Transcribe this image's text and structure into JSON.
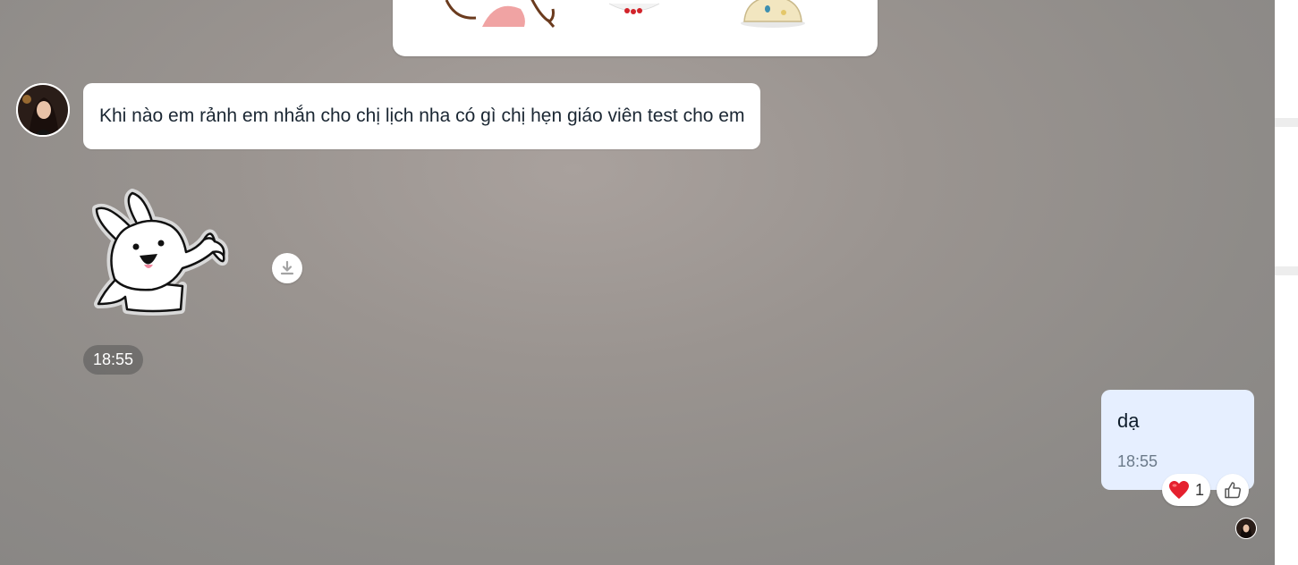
{
  "incoming_message": {
    "text": "Khi nào em rảnh em nhắn cho chị lịch nha có gì chị hẹn giáo viên test cho em",
    "sticker_time": "18:55"
  },
  "outgoing_message": {
    "text": "dạ",
    "time": "18:55",
    "reaction": {
      "icon": "heart-icon",
      "count": "1"
    }
  },
  "colors": {
    "incoming_bubble": "#ffffff",
    "outgoing_bubble": "#e6efff",
    "time_pill": "#555555",
    "heart": "#e5202e"
  }
}
